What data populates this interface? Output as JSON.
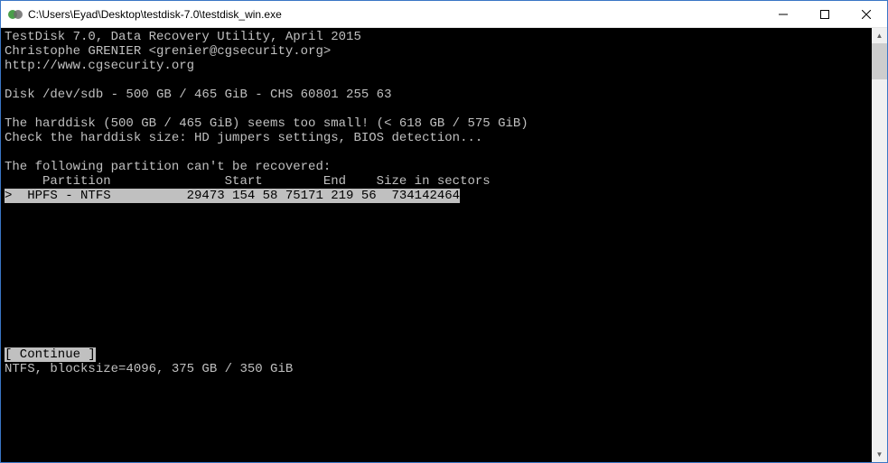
{
  "window": {
    "title": "C:\\Users\\Eyad\\Desktop\\testdisk-7.0\\testdisk_win.exe"
  },
  "console": {
    "line1": "TestDisk 7.0, Data Recovery Utility, April 2015",
    "line2": "Christophe GRENIER <grenier@cgsecurity.org>",
    "line3": "http://www.cgsecurity.org",
    "blank1": "",
    "disk_info": "Disk /dev/sdb - 500 GB / 465 GiB - CHS 60801 255 63",
    "blank2": "",
    "warn1": "The harddisk (500 GB / 465 GiB) seems too small! (< 618 GB / 575 GiB)",
    "warn2": "Check the harddisk size: HD jumpers settings, BIOS detection...",
    "blank3": "",
    "recover_header": "The following partition can't be recovered:",
    "columns": "     Partition               Start        End    Size in sectors",
    "row_hl": ">  HPFS - NTFS          29473 154 58 75171 219 56  734142464",
    "continue_btn": "[ Continue ]",
    "footer": "NTFS, blocksize=4096, 375 GB / 350 GiB"
  }
}
